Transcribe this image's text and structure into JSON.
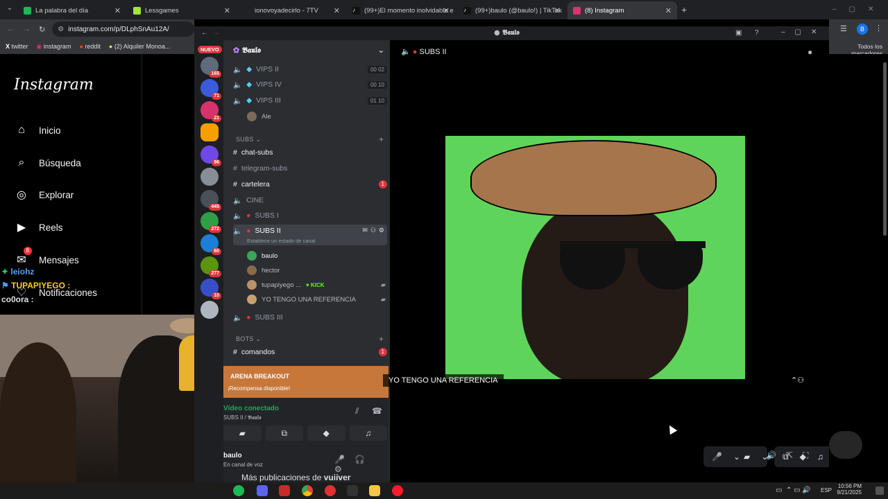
{
  "browser": {
    "tabs": [
      {
        "title": "La palabra del día",
        "color": "#1db954"
      },
      {
        "title": "Lessgames",
        "color": "#2a2a2a"
      },
      {
        "title": "ionovoyadecirlo - 7TV",
        "color": "#6b6b6b"
      },
      {
        "title": "(99+)El momento inolvidable e",
        "color": "#111"
      },
      {
        "title": "(99+)baulo (@baulo!) | TikTok",
        "color": "#111"
      },
      {
        "title": "(8) Instagram",
        "color": "#e1306c"
      }
    ],
    "url": "instagram.com/p/DLphSnAu12A/",
    "bookmarks": [
      "twitter",
      "instagram",
      "reddit",
      "(2) Alquiler Monoa..."
    ],
    "all_bookmarks": "Todos los marcadores",
    "profile_letter": "B"
  },
  "instagram": {
    "logo": "Instagram",
    "nav": [
      {
        "label": "Inicio",
        "icon": "home-icon",
        "glyph": "⌂"
      },
      {
        "label": "Búsqueda",
        "icon": "search-icon",
        "glyph": "⌕"
      },
      {
        "label": "Explorar",
        "icon": "compass-icon",
        "glyph": "◎"
      },
      {
        "label": "Reels",
        "icon": "reels-icon",
        "glyph": "▶"
      },
      {
        "label": "Mensajes",
        "icon": "messenger-icon",
        "glyph": "✉",
        "badge": "8"
      },
      {
        "label": "Notificaciones",
        "icon": "heart-icon",
        "glyph": "♡"
      }
    ],
    "more_posts_prefix": "Más publicaciones de",
    "more_posts_user": "vuiiver"
  },
  "chat_overlay": [
    {
      "name": "leiohz",
      "color": "#4aa3ff"
    },
    {
      "name": "TUPAPIYEGO :",
      "color": "#f7d21a"
    },
    {
      "name": "co0ora :",
      "color": "#e0e0e0"
    }
  ],
  "discord": {
    "window_title": "𝕭𝖆𝖚𝖑𝖔",
    "server_name": "𝕭𝖆𝖚𝖑𝖔",
    "new_label": "NUEVO",
    "server_badges": [
      "165",
      "71",
      "21",
      "",
      "96",
      "",
      "445",
      "272",
      "60",
      "277",
      "10",
      ""
    ],
    "channels": [
      {
        "name": "VIPS II",
        "type": "voice",
        "count_a": "00",
        "count_b": "02"
      },
      {
        "name": "VIPS IV",
        "type": "voice",
        "count_a": "00",
        "count_b": "10"
      },
      {
        "name": "VIPS III",
        "type": "voice",
        "count_a": "01",
        "count_b": "10"
      }
    ],
    "vip_member": "Ale",
    "cat_subs": "SUBS",
    "text_channels": [
      {
        "name": "chat-subs",
        "bright": true,
        "badge": ""
      },
      {
        "name": "telegram-subs",
        "bright": false,
        "badge": ""
      },
      {
        "name": "cartelera",
        "bright": true,
        "badge": "1"
      },
      {
        "name": "CINE",
        "bright": false,
        "badge": ""
      },
      {
        "name": "SUBS I",
        "bright": false,
        "badge": ""
      }
    ],
    "selected_channel": "SUBS II",
    "channel_status": "Establece un estado de canal",
    "voice_members": [
      {
        "name": "baulo",
        "bright": true,
        "extra": ""
      },
      {
        "name": "hector",
        "bright": false,
        "extra": ""
      },
      {
        "name": "tupapiyego ...",
        "bright": false,
        "extra": "KICK"
      },
      {
        "name": "YO TENGO UNA REFERENCIA",
        "bright": false,
        "extra": ""
      }
    ],
    "subs_iii": "SUBS III",
    "cat_bots": "BOTS",
    "commands_channel": "comandos",
    "commands_badge": "1",
    "promo_brand": "ARENA BREAKOUT",
    "promo_text": "¡Recompensa disponible!",
    "voice_status": "Vídeo conectado",
    "voice_location": "SUBS II / 𝕭𝖆𝖚𝖑𝖔",
    "user_name": "baulo",
    "user_status": "En canal de voz",
    "stage_channel": "SUBS II",
    "video_label": "YO TENGO UNA REFERENCIA"
  },
  "taskbar": {
    "lang": "ESP",
    "time": "10:56 PM",
    "date": "9/21/2025"
  },
  "colors": {
    "discord_red": "#da373c",
    "discord_green": "#23a55a",
    "promo_orange": "#c7773a"
  }
}
